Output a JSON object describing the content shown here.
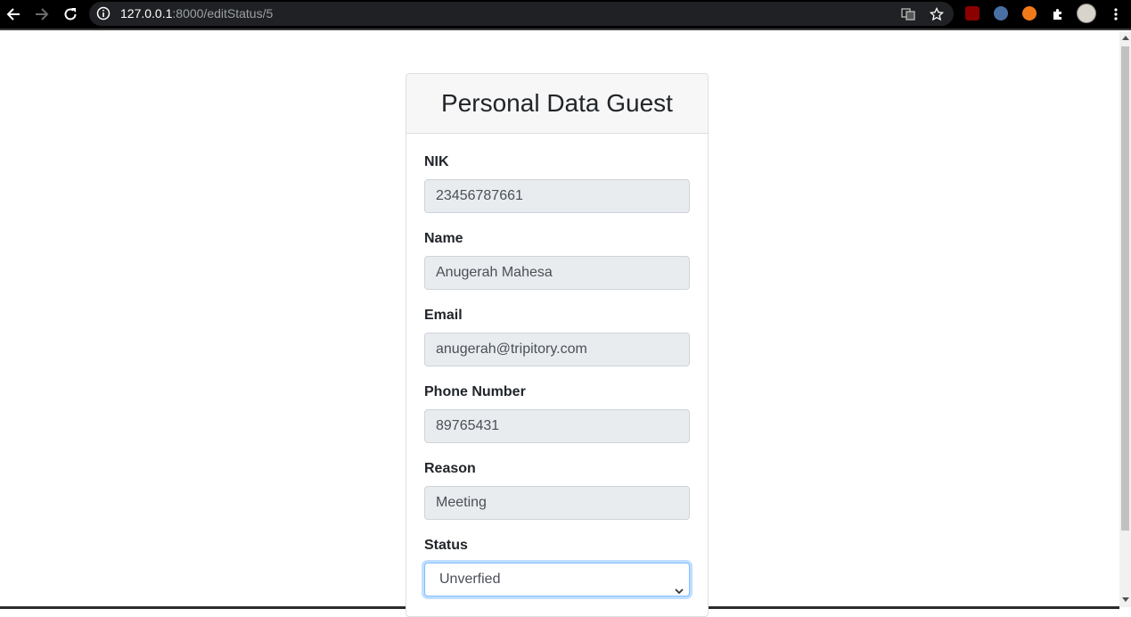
{
  "browser": {
    "url_host": "127.0.0.1",
    "url_path": ":8000/editStatus/5"
  },
  "card": {
    "title": "Personal Data Guest"
  },
  "fields": [
    {
      "label": "NIK",
      "value": "23456787661"
    },
    {
      "label": "Name",
      "value": "Anugerah Mahesa"
    },
    {
      "label": "Email",
      "value": "anugerah@tripitory.com"
    },
    {
      "label": "Phone Number",
      "value": "89765431"
    },
    {
      "label": "Reason",
      "value": "Meeting"
    }
  ],
  "status": {
    "label": "Status",
    "selected": "Unverfied"
  },
  "colors": {
    "toolbar_bg": "#000000",
    "field_disabled_bg": "#e9ecef",
    "focus_border": "#80bdff"
  }
}
